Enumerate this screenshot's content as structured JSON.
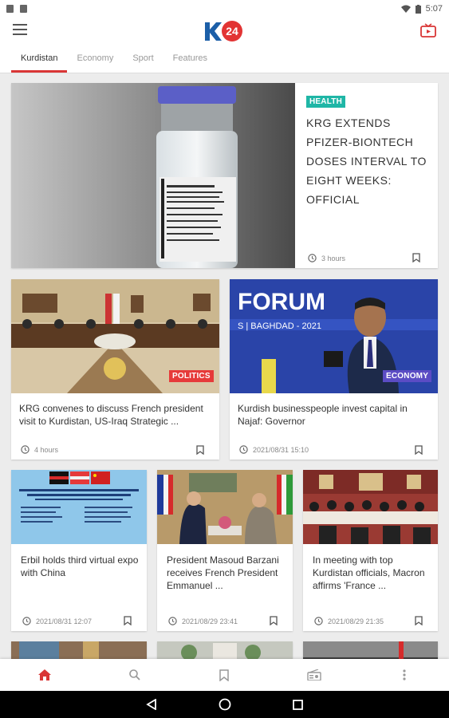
{
  "status": {
    "time": "5:07"
  },
  "app": {
    "logo_text": "K24"
  },
  "tabs": [
    "Kurdistan",
    "Economy",
    "Sport",
    "Features"
  ],
  "featured": {
    "badge": "HEALTH",
    "title": "KRG EXTENDS PFIZER-BIONTECH DOSES INTERVAL TO EIGHT WEEKS: OFFICIAL",
    "time": "3 hours"
  },
  "row2": [
    {
      "badge": "POLITICS",
      "title": "KRG convenes to discuss French president visit to Kurdistan, US-Iraq Strategic ...",
      "time": "4 hours"
    },
    {
      "badge": "ECONOMY",
      "title": "Kurdish businesspeople invest capital in Najaf: Governor",
      "time": "2021/08/31 15:10"
    }
  ],
  "row3": [
    {
      "title": "Erbil holds third virtual expo with China",
      "time": "2021/08/31 12:07"
    },
    {
      "title": "President Masoud Barzani receives French President Emmanuel ...",
      "time": "2021/08/29 23:41"
    },
    {
      "title": "In meeting with top Kurdistan officials, Macron affirms 'France ...",
      "time": "2021/08/29 21:35"
    }
  ],
  "images": {
    "forum_text": "FORUM",
    "forum_sub": "S | BAGHDAD - 2021"
  },
  "colors": {
    "accent": "#d93636",
    "health": "#1fb6a6",
    "politics": "#e63a3a",
    "economy": "#5b4cc4"
  },
  "icons": [
    "menu-icon",
    "live-tv-icon",
    "clock-icon",
    "bookmark-icon",
    "home-icon",
    "search-icon",
    "radio-icon",
    "more-icon"
  ]
}
